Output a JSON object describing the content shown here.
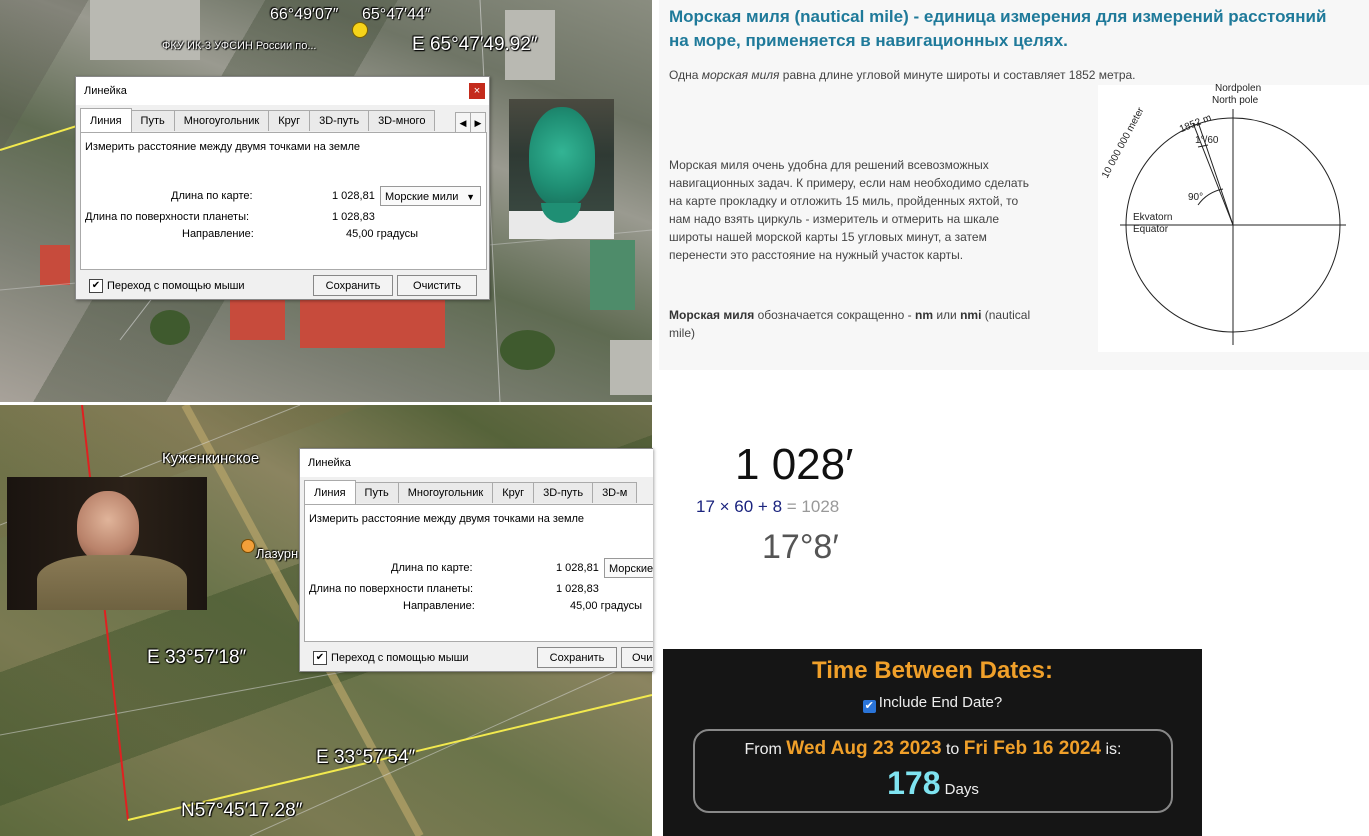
{
  "map_top": {
    "coord_label_1": "66°49′07″",
    "coord_label_2": "65°47′44″",
    "place_label": "ФКУ ИК-3 УФСИН России по...",
    "coord_label_3": "E 65°47′49.92″"
  },
  "map_bottom": {
    "place_label_1": "Куженкинское",
    "place_label_2": "Лазурн",
    "coord_label_1": "E 33°57′18″",
    "coord_label_2": "E 33°57′54″",
    "coord_label_3": "N57°45′17.28″"
  },
  "ruler_dialog_1": {
    "title": "Линейка",
    "close": "×",
    "tabs": [
      "Линия",
      "Путь",
      "Многоугольник",
      "Круг",
      "3D-путь",
      "3D-много"
    ],
    "description": "Измерить расстояние между двумя точками на земле",
    "map_length_label": "Длина по карте:",
    "map_length_value": "1 028,81",
    "units": "Морские мили",
    "surface_length_label": "Длина по поверхности планеты:",
    "surface_length_value": "1 028,83",
    "direction_label": "Направление:",
    "direction_value": "45,00 градусы",
    "mouse_nav_label": "Переход с помощью мыши",
    "save_label": "Сохранить",
    "clear_label": "Очистить"
  },
  "ruler_dialog_2": {
    "title": "Линейка",
    "tabs": [
      "Линия",
      "Путь",
      "Многоугольник",
      "Круг",
      "3D-путь",
      "3D-м"
    ],
    "description": "Измерить расстояние между двумя точками на земле",
    "map_length_label": "Длина по карте:",
    "map_length_value": "1 028,81",
    "units": "Морские",
    "surface_length_label": "Длина по поверхности планеты:",
    "surface_length_value": "1 028,83",
    "direction_label": "Направление:",
    "direction_value": "45,00 градусы",
    "mouse_nav_label": "Переход с помощью мыши",
    "save_label": "Сохранить",
    "clear_label": "Очи"
  },
  "nautical_mile": {
    "title": "Морская миля (nautical mile) - единица измерения для измерений расстояний на море, применяется в навигационных целях.",
    "p1_a": "Одна ",
    "p1_em": "морская миля",
    "p1_b": " равна длине угловой минуте широты и составляет 1852 метра.",
    "p2_l1": "Морская миля очень удобна для решений всевозможных",
    "p2_l2": "навигационных задач. К примеру, если нам необходимо  сделать",
    "p2_l3": "на карте прокладку и  отложить 15 миль, пройденных яхтой, то",
    "p2_l4": "нам надо взять циркуль - измеритель и отмерить на шкале",
    "p2_l5": "широты нашей морской карты  15 угловых минут, а затем",
    "p2_l6": "перенести это расстояние на нужный участок карты.",
    "p3_strong": "Морская миля",
    "p3_a": " обозначается сокращенно  - ",
    "p3_nm": "nm",
    "p3_or": " или ",
    "p3_nmi": "nmi",
    "p3_b": " (nautical",
    "p3_l2": "mile)",
    "diagram": {
      "nordpolen": "Nordpolen",
      "north_pole": "North pole",
      "meter_label": "10 000 000 meter",
      "m1852": "1852 m",
      "fraction": "1°/60",
      "angle": "90°",
      "ekvatorn": "Ekvatorn",
      "equator": "Equator"
    }
  },
  "arithmetic": {
    "big": "1 028′",
    "expr": "17 × 60 + 8",
    "eq": " = 1028",
    "result": "17°8′"
  },
  "time_between_dates": {
    "title": "Time Between Dates:",
    "include_end_label": "Include End Date?",
    "from_label": "From ",
    "from_date": "Wed Aug 23 2023",
    "to_label": " to ",
    "to_date": "Fri Feb 16 2024",
    "is_label": " is:",
    "days_value": "178",
    "days_label": " Days"
  },
  "colors": {
    "title_teal": "#1f7a9a",
    "orange": "#f0a02a",
    "days_cyan": "#7fe3f0",
    "navy": "#1a237e",
    "measure_line_yellow": "#f2e94e",
    "measure_line_red": "#e02020"
  }
}
